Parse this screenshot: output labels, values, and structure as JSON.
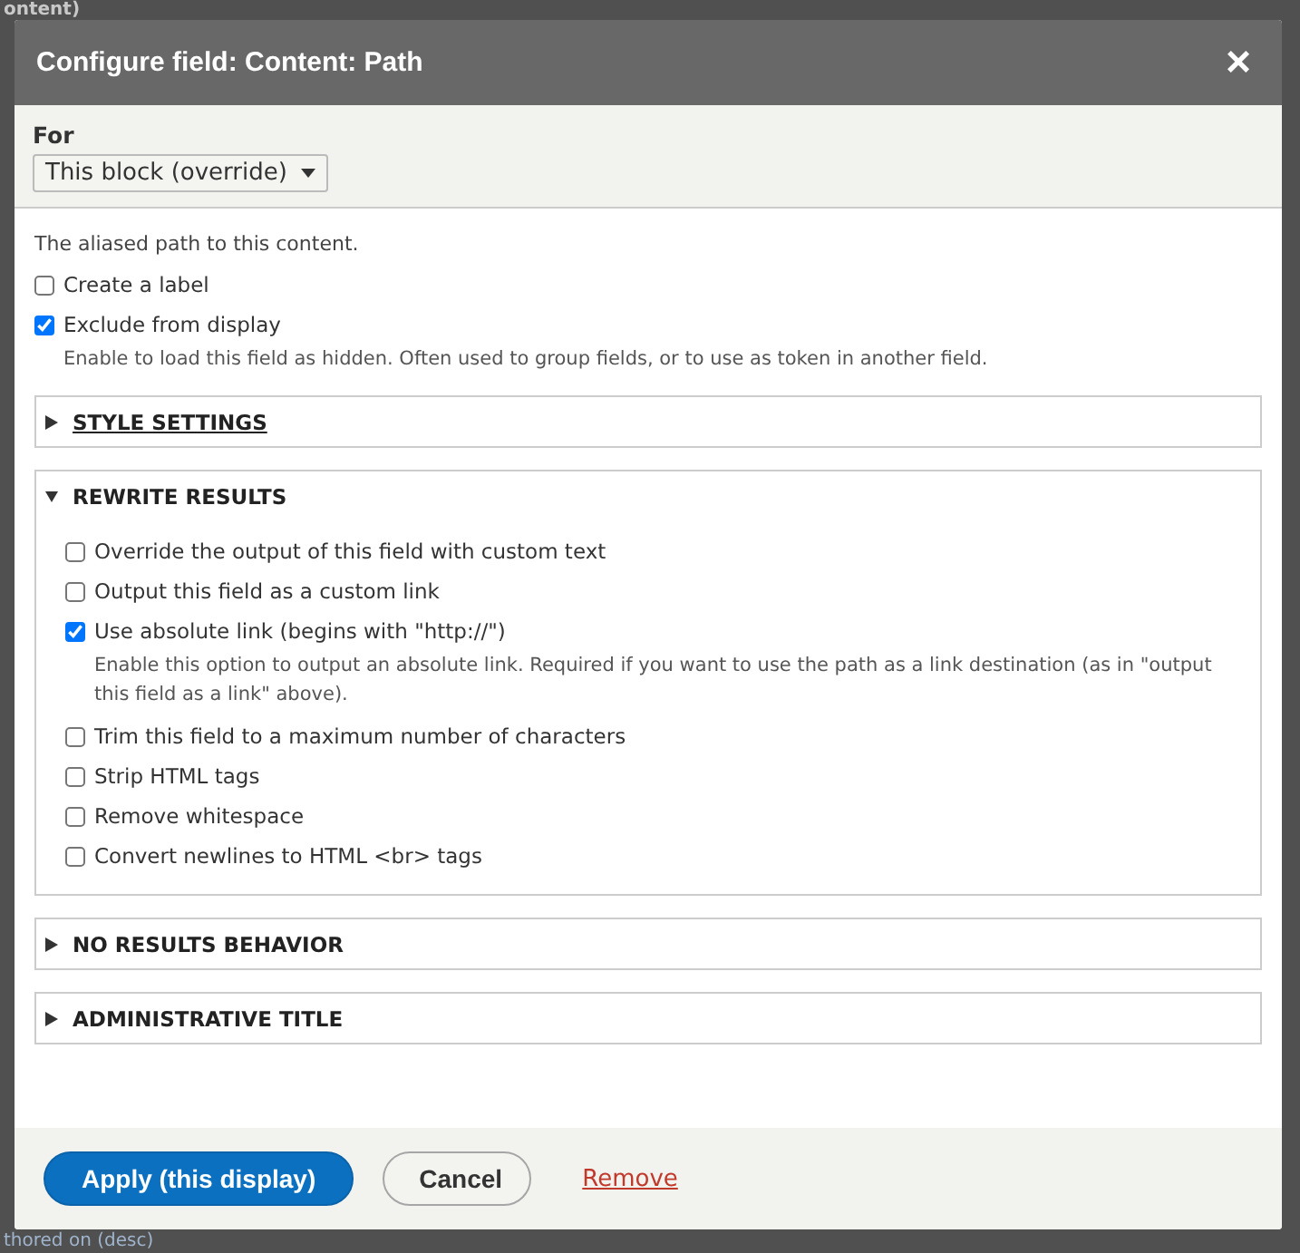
{
  "background": {
    "heading": "ontent)",
    "footer_text": "thored on (desc)"
  },
  "dialog": {
    "title": "Configure field: Content: Path",
    "close": "×"
  },
  "for": {
    "label": "For",
    "value": "This block (override)"
  },
  "intro": "The aliased path to this content.",
  "options": [
    {
      "label": "Create a label",
      "checked": false
    },
    {
      "label": "Exclude from display",
      "checked": true,
      "description": "Enable to load this field as hidden. Often used to group fields, or to use as token in another field."
    }
  ],
  "sections": [
    {
      "title": "STYLE SETTINGS",
      "expanded": false,
      "underlined": true
    },
    {
      "title": "REWRITE RESULTS",
      "expanded": true,
      "underlined": false,
      "items": [
        {
          "label": "Override the output of this field with custom text",
          "checked": false
        },
        {
          "label": "Output this field as a custom link",
          "checked": false
        },
        {
          "label": "Use absolute link (begins with \"http://\")",
          "checked": true,
          "description": "Enable this option to output an absolute link. Required if you want to use the path as a link destination (as in \"output this field as a link\" above)."
        },
        {
          "label": "Trim this field to a maximum number of characters",
          "checked": false
        },
        {
          "label": "Strip HTML tags",
          "checked": false
        },
        {
          "label": "Remove whitespace",
          "checked": false
        },
        {
          "label": "Convert newlines to HTML <br> tags",
          "checked": false
        }
      ]
    },
    {
      "title": "NO RESULTS BEHAVIOR",
      "expanded": false,
      "underlined": false
    },
    {
      "title": "ADMINISTRATIVE TITLE",
      "expanded": false,
      "underlined": false
    }
  ],
  "buttons": [
    {
      "kind": "primary",
      "label": "Apply (this display)"
    },
    {
      "kind": "secondary",
      "label": "Cancel"
    },
    {
      "kind": "link",
      "label": "Remove"
    }
  ]
}
